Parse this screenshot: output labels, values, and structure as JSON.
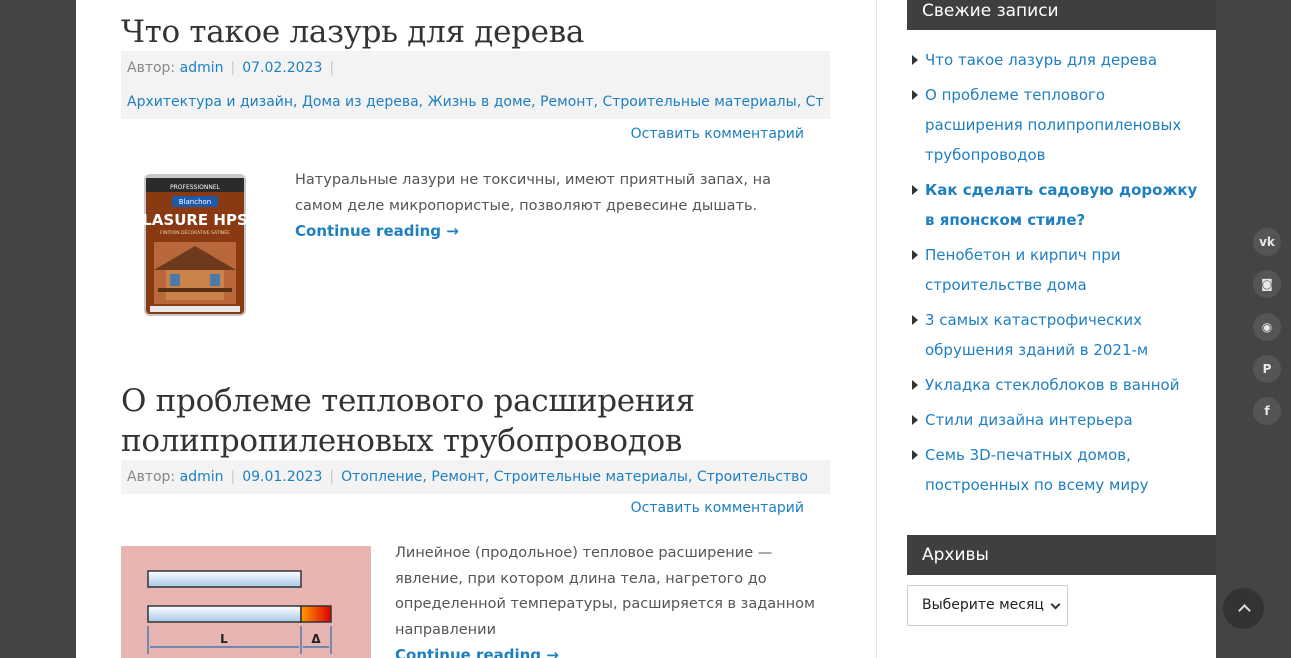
{
  "posts": [
    {
      "title": "Что такое лазурь для дерева",
      "author_label": "Автор:",
      "author": "admin",
      "date": "07.02.2023",
      "categories": [
        "Архитектура и дизайн",
        "Дома из дерева",
        "Жизнь в доме",
        "Ремонт",
        "Строительные материалы",
        "Строительство"
      ],
      "comment_link": "Оставить комментарий",
      "excerpt": "Натуральные лазури не токсичны, имеют приятный запах, на самом деле микропористые, позволяют древесине дышать.",
      "more": "Continue reading →",
      "image": {
        "brand": "Blanchon",
        "top_text": "PROFESSIONNEL",
        "product": "LASURE HPS",
        "subtitle": "FINITION DÉCORATIVE SATINÉE"
      }
    },
    {
      "title_line1": "О проблеме теплового расширения",
      "title_line2": "полипропиленовых трубопроводов",
      "author_label": "Автор:",
      "author": "admin",
      "date": "09.01.2023",
      "categories": [
        "Отопление",
        "Ремонт",
        "Строительные материалы",
        "Строительство"
      ],
      "comment_link": "Оставить комментарий",
      "excerpt": "Линейное (продольное) тепловое расширение — явление, при котором длина тела, нагретого до определенной температуры, расширяется в заданном направлении",
      "more": "Continue reading →",
      "image": {
        "label_l": "L",
        "label_delta": "Δ"
      }
    }
  ],
  "sidebar": {
    "recent_title": "Свежие записи",
    "recent_posts": [
      {
        "label": "Что такое лазурь для дерева",
        "bold": false
      },
      {
        "label": "О проблеме теплового расширения полипропиленовых трубопроводов",
        "bold": false
      },
      {
        "label": "Как сделать садовую дорожку в японском стиле?",
        "bold": true
      },
      {
        "label": "Пенобетон и кирпич при строительстве дома",
        "bold": false
      },
      {
        "label": "3 самых катастрофических обрушения зданий в 2021-м",
        "bold": false
      },
      {
        "label": "Укладка стеклоблоков в ванной",
        "bold": false
      },
      {
        "label": "Стили дизайна интерьера",
        "bold": false
      },
      {
        "label": "Семь 3D-печатных домов, построенных по всему миру",
        "bold": false
      }
    ],
    "archives_title": "Архивы",
    "archive_select": "Выберите месяц"
  },
  "social": [
    {
      "icon": "vk-icon",
      "glyph": "vk"
    },
    {
      "icon": "instagram-icon",
      "glyph": "◙"
    },
    {
      "icon": "rss-icon",
      "glyph": "◉"
    },
    {
      "icon": "pinterest-icon",
      "glyph": "P"
    },
    {
      "icon": "facebook-icon",
      "glyph": "f"
    }
  ],
  "colors": {
    "link": "#1e7fc1",
    "background": "#444444",
    "widget_title_bg": "#3f3f3f"
  }
}
